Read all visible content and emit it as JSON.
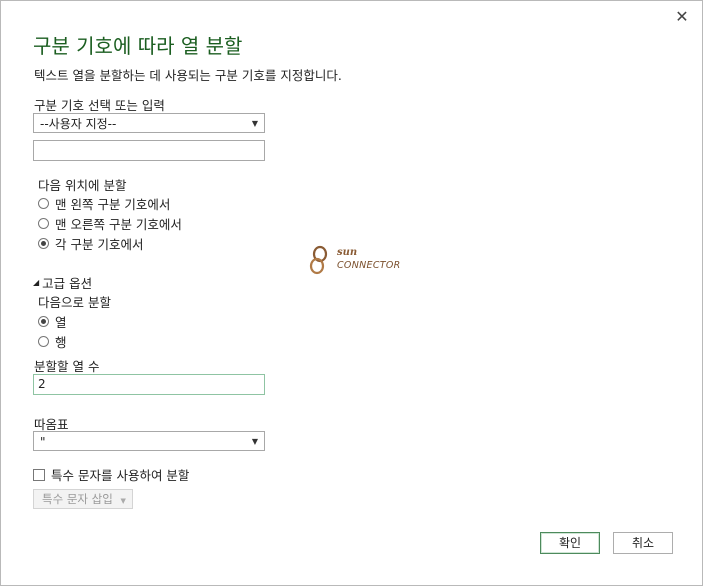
{
  "dialog": {
    "title": "구분 기호에 따라 열 분할",
    "subtitle": "텍스트 열을 분할하는 데 사용되는 구분 기호를 지정합니다.",
    "close_glyph": "✕"
  },
  "delimiter": {
    "label": "구분 기호 선택 또는 입력",
    "selected": "--사용자 지정--",
    "custom_value": ""
  },
  "split_at": {
    "label": "다음 위치에 분할",
    "options": [
      {
        "label": "맨 왼쪽 구분 기호에서",
        "checked": false
      },
      {
        "label": "맨 오른쪽 구분 기호에서",
        "checked": false
      },
      {
        "label": "각 구분 기호에서",
        "checked": true
      }
    ]
  },
  "advanced": {
    "toggle_label": "고급 옵션",
    "split_into_label": "다음으로 분할",
    "split_into_options": [
      {
        "label": "열",
        "checked": true
      },
      {
        "label": "행",
        "checked": false
      }
    ],
    "column_count_label": "분할할 열 수",
    "column_count_value": "2",
    "quote_label": "따옴표",
    "quote_selected": "\"",
    "special_chars_label": "특수 문자를 사용하여 분할",
    "special_chars_checked": false,
    "insert_special_label": "특수 문자 삽입"
  },
  "watermark": {
    "line1": "sun",
    "line2": "CONNECTOR"
  },
  "buttons": {
    "ok": "확인",
    "cancel": "취소"
  },
  "colors": {
    "title": "#1b5e20",
    "primary_border": "#4d8a5c"
  }
}
